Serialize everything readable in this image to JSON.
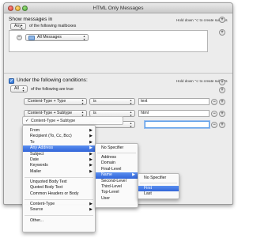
{
  "window": {
    "title": "HTML Only Messages"
  },
  "messages_section": {
    "label": "Show messages in",
    "hint": "Hold down ⌥ to create subsets",
    "any_popup": "Any",
    "of_following": "of the following mailboxes",
    "mailbox_popup": "All Messages"
  },
  "conditions_section": {
    "checkbox_checked": true,
    "label": "Under the following conditions:",
    "hint": "Hold down ⌥ to create subsets",
    "all_popup": "All",
    "of_following": "of the following are true",
    "rows": [
      {
        "field": "Content-Type + Type",
        "op": "is",
        "value": "text"
      },
      {
        "field": "Content-Type + Subtype",
        "op": "is",
        "value": "html"
      },
      {
        "field": "Content-Type + Subtype",
        "op": "is",
        "value": ""
      }
    ]
  },
  "menu_main": {
    "checked_item": "Content-Type + Subtype",
    "items": [
      {
        "label": "From",
        "submenu": true
      },
      {
        "label": "Recipient (To, Cc, Bcc)",
        "submenu": true
      },
      {
        "label": "To",
        "submenu": true
      },
      {
        "label": "Any Address",
        "submenu": true,
        "highlighted": true
      },
      {
        "label": "Subject",
        "submenu": true
      },
      {
        "label": "Date",
        "submenu": true
      },
      {
        "label": "Keywords",
        "submenu": true
      },
      {
        "label": "Mailer",
        "submenu": true
      },
      {
        "label": "Unquoted Body Text",
        "submenu": false
      },
      {
        "label": "Quoted Body Text",
        "submenu": false
      },
      {
        "label": "Common Headers or Body",
        "submenu": false
      },
      {
        "label": "Content-Type",
        "submenu": true
      },
      {
        "label": "Source",
        "submenu": true
      },
      {
        "label": "Other...",
        "submenu": false
      }
    ]
  },
  "menu_address": {
    "items": [
      {
        "label": "No Specifier"
      },
      {
        "label": "Address"
      },
      {
        "label": "Domain"
      },
      {
        "label": "Final-Level"
      },
      {
        "label": "Name",
        "submenu": true,
        "highlighted": true
      },
      {
        "label": "Second-Level"
      },
      {
        "label": "Third-Level"
      },
      {
        "label": "Top-Level"
      },
      {
        "label": "User"
      }
    ]
  },
  "menu_name": {
    "items": [
      {
        "label": "No Specifier"
      },
      {
        "label": "First",
        "highlighted": true
      },
      {
        "label": "Last"
      }
    ]
  },
  "colors": {
    "accent": "#3a6fdc",
    "window_bg": "#ececec"
  }
}
